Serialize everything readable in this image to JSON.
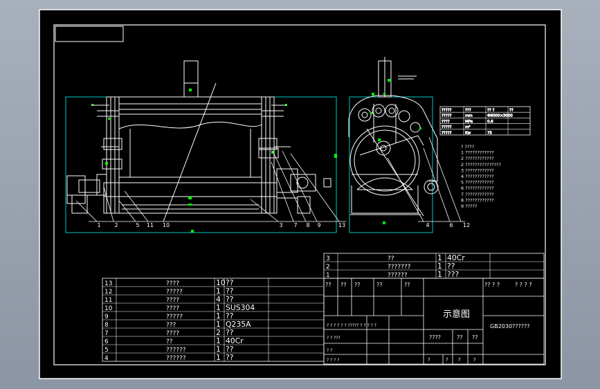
{
  "colors": {
    "background": "#000000",
    "frame": "#ffffff",
    "cyan": "#00c8c8",
    "green": "#00ff00",
    "viewport": "#9aa3b1"
  },
  "front_view": {
    "balloons": [
      "1",
      "2",
      "5",
      "11",
      "10",
      "3",
      "7",
      "8",
      "9",
      "13"
    ]
  },
  "side_view": {
    "balloons": [
      "4",
      "6",
      "12"
    ]
  },
  "spec_table": {
    "rows": [
      [
        "?????",
        "???",
        "?? ?",
        "??"
      ],
      [
        "?????",
        "mm",
        "Φ8000×3000",
        ""
      ],
      [
        "????",
        "MPa",
        "0.6",
        ""
      ],
      [
        "?????",
        "m²",
        "",
        ""
      ],
      [
        "?????",
        "Kw",
        "75",
        ""
      ]
    ]
  },
  "tech_notes": {
    "lines": [
      "?  ????",
      "1 ????????????",
      "2 ????????????",
      "2 ???????????????",
      "3 ????????????",
      "4 ????????????",
      "5 ????????????",
      "6 ????????????",
      "7 ????????????",
      "8 ????????????",
      "9 ?????"
    ]
  },
  "parts_list_upper": [
    {
      "no": "3",
      "name": "??",
      "qty": "1",
      "material": "40Cr"
    },
    {
      "no": "2",
      "name": "???????",
      "qty": "1",
      "material": "??"
    },
    {
      "no": "1",
      "name": "??????",
      "qty": "1",
      "material": "???"
    }
  ],
  "parts_list_lower": [
    {
      "no": "13",
      "name": "????",
      "qty": "10",
      "material": "??"
    },
    {
      "no": "12",
      "name": "?????",
      "qty": "1",
      "material": "??"
    },
    {
      "no": "11",
      "name": "????",
      "qty": "4",
      "material": "??"
    },
    {
      "no": "10",
      "name": "????",
      "qty": "1",
      "material": "SUS304"
    },
    {
      "no": "9",
      "name": "?????",
      "qty": "1",
      "material": "??"
    },
    {
      "no": "8",
      "name": "???",
      "qty": "1",
      "material": "Q235A"
    },
    {
      "no": "7",
      "name": "????",
      "qty": "2",
      "material": "??"
    },
    {
      "no": "6",
      "name": "??",
      "qty": "1",
      "material": "40Cr"
    },
    {
      "no": "5",
      "name": "??????",
      "qty": "1",
      "material": "??"
    },
    {
      "no": "4",
      "name": "??????",
      "qty": "1",
      "material": "??"
    }
  ],
  "header_cells": [
    "??",
    "??",
    "??",
    "??",
    "??",
    "?? ? ?",
    "? ? ? ?"
  ],
  "title_block": {
    "drawing_title": "示意图",
    "drawing_number": "GB2030??????",
    "scale_cells": [
      "????",
      "??",
      "??"
    ],
    "row_labels": [
      "? ? ? ?  ? ?  ?????  ? ?  ? ? ?",
      "? ?   ???",
      "? ?",
      "? ?  ? ?"
    ],
    "bottom_cells": [
      "?",
      "?",
      "?",
      "?"
    ]
  }
}
